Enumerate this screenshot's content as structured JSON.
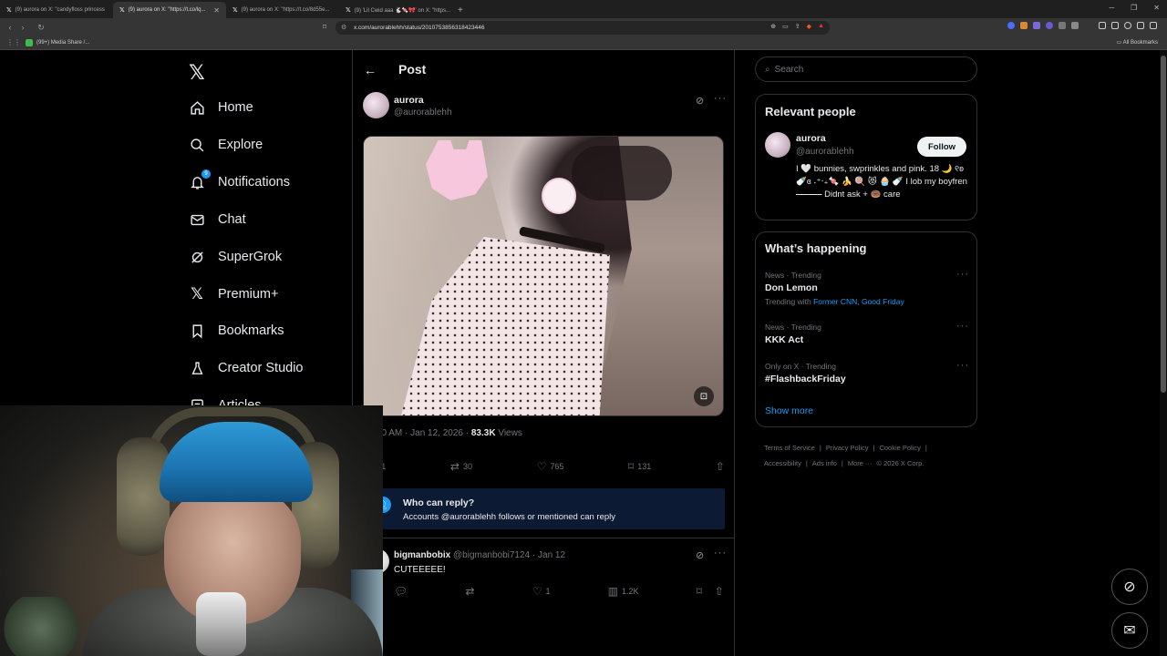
{
  "browser": {
    "tabs": [
      {
        "label": "(9) aurora on X: \"candyfloss princess",
        "active": false
      },
      {
        "label": "(9) aurora on X: \"https://t.co/lq...",
        "active": true
      },
      {
        "label": "(9) aurora on X: \"https://t.co/8d55e...",
        "active": false
      },
      {
        "label": "(9) 'Lil Cwid aaa 🐇🍬🎀' on X: \"https...",
        "active": false
      }
    ],
    "new_tab": "+",
    "url": "x.com/aurorablehh/status/2010753856318423446",
    "bookmark": "(99+) Media Share /...",
    "all_bookmarks": "All Bookmarks"
  },
  "sidebar": {
    "logo": "𝕏",
    "items": [
      {
        "label": "Home",
        "icon": "home-icon"
      },
      {
        "label": "Explore",
        "icon": "search-icon"
      },
      {
        "label": "Notifications",
        "icon": "bell-icon"
      },
      {
        "label": "Chat",
        "icon": "mail-icon"
      },
      {
        "label": "SuperGrok",
        "icon": "grok-icon"
      },
      {
        "label": "Premium+",
        "icon": "x-logo-icon"
      },
      {
        "label": "Bookmarks",
        "icon": "bookmark-icon"
      },
      {
        "label": "Creator Studio",
        "icon": "flask-icon"
      },
      {
        "label": "Articles",
        "icon": "article-icon"
      }
    ]
  },
  "header": {
    "title": "Post"
  },
  "post": {
    "name": "aurora",
    "handle": "@aurorablehh",
    "time": "10:40 AM · Jan 12, 2026 · ",
    "views_count": "83.3K",
    "views_label": " Views",
    "replies": "1",
    "reposts": "30",
    "likes": "765",
    "bookmarks": "131"
  },
  "reply_banner": {
    "title": "Who can reply?",
    "subtitle": "Accounts @aurorablehh follows or mentioned can reply"
  },
  "reply": {
    "name": "bigmanbobix",
    "handle": "@bigmanbobi7124 · Jan 12",
    "text": "CUTEEEEE!",
    "likes": "1",
    "views": "1.2K"
  },
  "search": {
    "placeholder": "Search"
  },
  "relevant_people": {
    "title": "Relevant people",
    "name": "aurora",
    "handle": "@aurorablehh",
    "follow": "Follow",
    "bio": "I 🤍 bunnies, swprinkles and pink. 18 🌙 ୧ʚ🍼ɞ ˖⁺‧₊🍬 🍌 🍭 😻 🧁 🍼 I lob my boyfren ⎯⎯⎯⎯⎯⎯ Didnt ask + 🍩 care"
  },
  "whats_happening": {
    "title": "What’s happening",
    "trends": [
      {
        "category": "News · Trending",
        "name": "Don Lemon",
        "with_prefix": "Trending with ",
        "with_links": "Former CNN, Good Friday"
      },
      {
        "category": "News · Trending",
        "name": "KKK Act"
      },
      {
        "category": "Only on X · Trending",
        "name": "#FlashbackFriday"
      }
    ],
    "show_more": "Show more"
  },
  "footer": {
    "line1": [
      "Terms of Service",
      "|",
      "Privacy Policy",
      "|",
      "Cookie Policy",
      "|"
    ],
    "line2": [
      "Accessibility",
      "|",
      "Ads info",
      "|",
      "More ···",
      "© 2026 X Corp."
    ]
  },
  "colors": {
    "accent": "#1d9bf0",
    "background": "#000000",
    "text": "#e7e9ea",
    "muted": "#71767b"
  }
}
